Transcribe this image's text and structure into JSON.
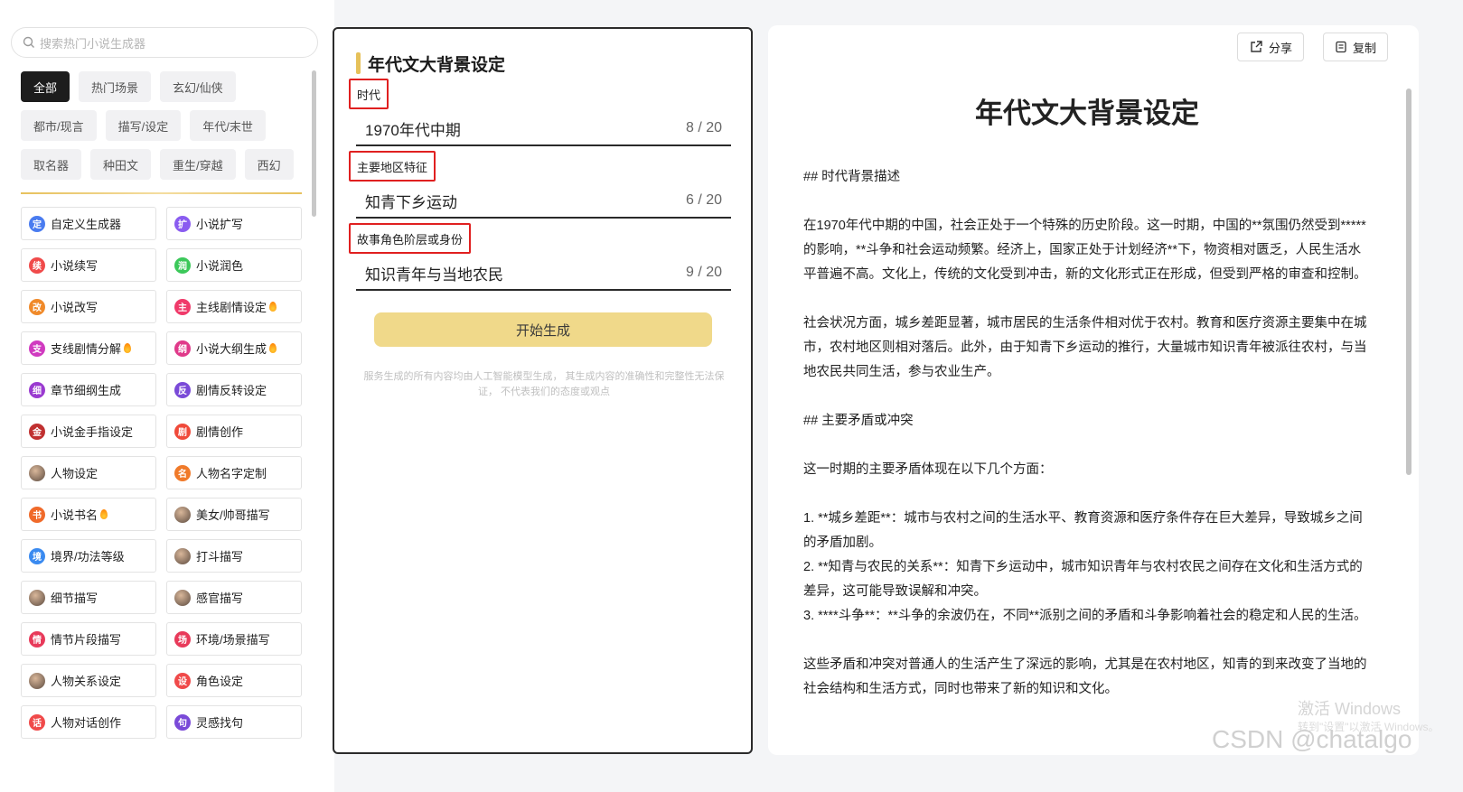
{
  "search": {
    "placeholder": "搜索热门小说生成器"
  },
  "tags": [
    "全部",
    "热门场景",
    "玄幻/仙侠",
    "都市/现言",
    "描写/设定",
    "年代/末世",
    "取名器",
    "种田文",
    "重生/穿越",
    "西幻"
  ],
  "tools": [
    {
      "label": "自定义生成器",
      "icon": "custom-icon",
      "glyph": "定",
      "color": "#4a7cf0",
      "hot": false
    },
    {
      "label": "小说扩写",
      "icon": "expand-icon",
      "glyph": "扩",
      "color": "#8a5cf0",
      "hot": false
    },
    {
      "label": "小说续写",
      "icon": "continue-icon",
      "glyph": "续",
      "color": "#f04a4a",
      "hot": false
    },
    {
      "label": "小说润色",
      "icon": "polish-icon",
      "glyph": "润",
      "color": "#3cc85a",
      "hot": false
    },
    {
      "label": "小说改写",
      "icon": "rewrite-icon",
      "glyph": "改",
      "color": "#f08a2a",
      "hot": false
    },
    {
      "label": "主线剧情设定",
      "icon": "main-plot-icon",
      "glyph": "主",
      "color": "#f03a6a",
      "hot": true
    },
    {
      "label": "支线剧情分解",
      "icon": "subplot-icon",
      "glyph": "支",
      "color": "#d03ac0",
      "hot": true
    },
    {
      "label": "小说大纲生成",
      "icon": "outline-icon",
      "glyph": "纲",
      "color": "#e03a8a",
      "hot": true
    },
    {
      "label": "章节细纲生成",
      "icon": "chapter-outline-icon",
      "glyph": "细",
      "color": "#9a3ad0",
      "hot": false
    },
    {
      "label": "剧情反转设定",
      "icon": "plot-twist-icon",
      "glyph": "反",
      "color": "#7a4ad8",
      "hot": false
    },
    {
      "label": "小说金手指设定",
      "icon": "golden-finger-icon",
      "glyph": "金",
      "color": "#c03030",
      "hot": false
    },
    {
      "label": "剧情创作",
      "icon": "plot-create-icon",
      "glyph": "剧",
      "color": "#f04a3a",
      "hot": false
    },
    {
      "label": "人物设定",
      "icon": "character-avatar-icon",
      "glyph": "",
      "color": "avatar",
      "hot": false
    },
    {
      "label": "人物名字定制",
      "icon": "name-icon",
      "glyph": "名",
      "color": "#f07a2a",
      "hot": false
    },
    {
      "label": "小说书名",
      "icon": "book-title-icon",
      "glyph": "书",
      "color": "#f06a2a",
      "hot": true
    },
    {
      "label": "美女/帅哥描写",
      "icon": "beauty-avatar-icon",
      "glyph": "",
      "color": "avatar",
      "hot": false
    },
    {
      "label": "境界/功法等级",
      "icon": "realm-icon",
      "glyph": "境",
      "color": "#3a8af0",
      "hot": false
    },
    {
      "label": "打斗描写",
      "icon": "fight-avatar-icon",
      "glyph": "",
      "color": "avatar",
      "hot": false
    },
    {
      "label": "细节描写",
      "icon": "detail-avatar-icon",
      "glyph": "",
      "color": "avatar",
      "hot": false
    },
    {
      "label": "感官描写",
      "icon": "sense-avatar-icon",
      "glyph": "",
      "color": "avatar",
      "hot": false
    },
    {
      "label": "情节片段描写",
      "icon": "plot-segment-icon",
      "glyph": "情",
      "color": "#e83a5a",
      "hot": false
    },
    {
      "label": "环境/场景描写",
      "icon": "scene-icon",
      "glyph": "场",
      "color": "#e83a5a",
      "hot": false
    },
    {
      "label": "人物关系设定",
      "icon": "relation-avatar-icon",
      "glyph": "",
      "color": "avatar",
      "hot": false
    },
    {
      "label": "角色设定",
      "icon": "role-icon",
      "glyph": "设",
      "color": "#f04a4a",
      "hot": false
    },
    {
      "label": "人物对话创作",
      "icon": "dialogue-icon",
      "glyph": "话",
      "color": "#f04a4a",
      "hot": false
    },
    {
      "label": "灵感找句",
      "icon": "inspiration-icon",
      "glyph": "句",
      "color": "#7a4ad8",
      "hot": false
    }
  ],
  "form": {
    "title": "年代文大背景设定",
    "fields": [
      {
        "label": "时代",
        "value": "1970年代中期",
        "count": "8 / 20"
      },
      {
        "label": "主要地区特征",
        "value": "知青下乡运动",
        "count": "6 / 20"
      },
      {
        "label": "故事角色阶层或身份",
        "value": "知识青年与当地农民",
        "count": "9 / 20"
      }
    ],
    "generate_label": "开始生成",
    "disclaimer": "服务生成的所有内容均由人工智能模型生成， 其生成内容的准确性和完整性无法保证， 不代表我们的态度或观点"
  },
  "output": {
    "share_label": "分享",
    "copy_label": "复制",
    "title": "年代文大背景设定",
    "paragraphs": [
      "## 时代背景描述",
      "在1970年代中期的中国，社会正处于一个特殊的历史阶段。这一时期，中国的**氛围仍然受到*****的影响，**斗争和社会运动频繁。经济上，国家正处于计划经济**下，物资相对匮乏，人民生活水平普遍不高。文化上，传统的文化受到冲击，新的文化形式正在形成，但受到严格的审查和控制。",
      "社会状况方面，城乡差距显著，城市居民的生活条件相对优于农村。教育和医疗资源主要集中在城市，农村地区则相对落后。此外，由于知青下乡运动的推行，大量城市知识青年被派往农村，与当地农民共同生活，参与农业生产。",
      "## 主要矛盾或冲突",
      "这一时期的主要矛盾体现在以下几个方面：",
      "1. **城乡差距**：城市与农村之间的生活水平、教育资源和医疗条件存在巨大差异，导致城乡之间的矛盾加剧。",
      "2. **知青与农民的关系**：知青下乡运动中，城市知识青年与农村农民之间存在文化和生活方式的差异，这可能导致误解和冲突。",
      "3. ****斗争**：**斗争的余波仍在，不同**派别之间的矛盾和斗争影响着社会的稳定和人民的生活。",
      "这些矛盾和冲突对普通人的生活产生了深远的影响，尤其是在农村地区，知青的到来改变了当地的社会结构和生活方式，同时也带来了新的知识和文化。"
    ]
  },
  "watermarks": {
    "windows_line1": "激活 Windows",
    "windows_line2": "转到\"设置\"以激活 Windows。",
    "csdn": "CSDN @chatalgo"
  },
  "colors": {
    "accent": "#e6c15a",
    "generate_button": "#f0d98a",
    "highlight_border": "#e02020"
  }
}
